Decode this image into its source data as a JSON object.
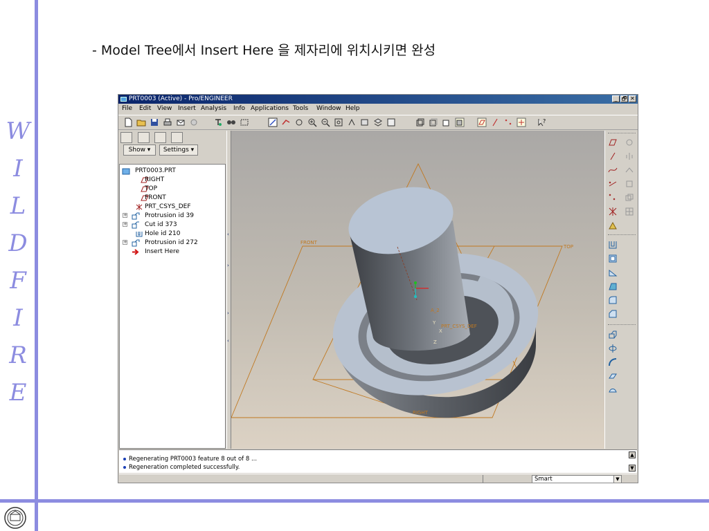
{
  "slide": {
    "title": "- Model Tree에서 Insert Here 을 제자리에 위치시키면 완성",
    "side_letters": [
      "W",
      "I",
      "L",
      "D",
      "F",
      "I",
      "R",
      "E"
    ]
  },
  "window": {
    "title": "PRT0003 (Active) - Pro/ENGINEER",
    "controls": [
      "_",
      "🗗",
      "✕"
    ]
  },
  "menu": [
    "File",
    "Edit",
    "View",
    "Insert",
    "Analysis",
    "Info",
    "Applications",
    "Tools",
    "Window",
    "Help"
  ],
  "left_panel": {
    "show_label": "Show ▾",
    "settings_label": "Settings ▾",
    "tree": [
      {
        "label": "PRT0003.PRT",
        "icon": "part-icon"
      },
      {
        "label": "RIGHT",
        "icon": "datum-plane-icon"
      },
      {
        "label": "TOP",
        "icon": "datum-plane-icon"
      },
      {
        "label": "FRONT",
        "icon": "datum-plane-icon"
      },
      {
        "label": "PRT_CSYS_DEF",
        "icon": "csys-icon"
      },
      {
        "label": "Protrusion id 39",
        "icon": "protrusion-icon"
      },
      {
        "label": "Cut id 373",
        "icon": "cut-icon"
      },
      {
        "label": "Hole id 210",
        "icon": "hole-icon"
      },
      {
        "label": "Protrusion id 272",
        "icon": "protrusion-icon"
      },
      {
        "label": "Insert Here",
        "icon": "insert-arrow-icon"
      }
    ]
  },
  "viewport": {
    "labels": {
      "front": "FRONT",
      "top": "TOP",
      "right": "RIGHT",
      "axis": "A_2",
      "csys": "PRT_CSYS_DEF",
      "y": "Y",
      "x": "X",
      "z": "Z"
    }
  },
  "messages": [
    "Regenerating PRT0003 feature 8 out of 8 ...",
    "Regeneration completed successfully."
  ],
  "status": {
    "filter_value": "Smart"
  },
  "colors": {
    "accent": "#8c8ce0",
    "titlebar": "#0a246a",
    "datum": "#c07820"
  }
}
